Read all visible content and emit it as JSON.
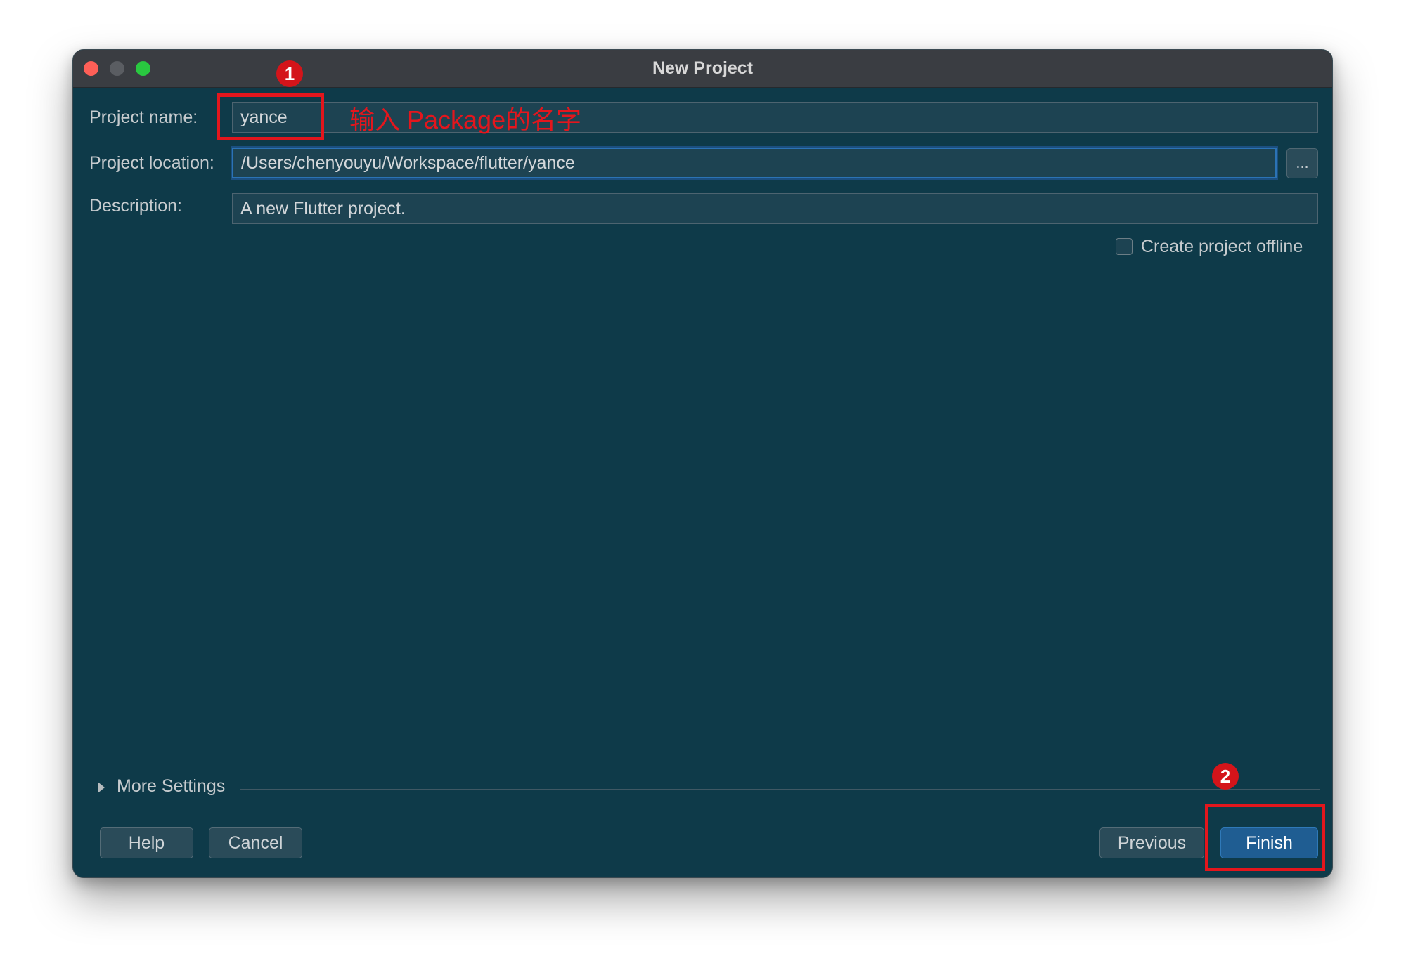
{
  "window": {
    "title": "New Project"
  },
  "form": {
    "project_name_label": "Project name:",
    "project_name_value": "yance",
    "project_location_label": "Project location:",
    "project_location_value": "/Users/chenyouyu/Workspace/flutter/yance",
    "browse_label": "...",
    "description_label": "Description:",
    "description_value": "A new Flutter project.",
    "offline_label": "Create project offline",
    "offline_checked": false
  },
  "more_settings": {
    "label": "More Settings"
  },
  "buttons": {
    "help": "Help",
    "cancel": "Cancel",
    "previous": "Previous",
    "finish": "Finish"
  },
  "annotations": {
    "badge_1": "1",
    "badge_2": "2",
    "hint_text": "输入 Package的名字",
    "color": "#e3161d"
  },
  "colors": {
    "window_background": "#0e3a49",
    "titlebar": "#3a3d42",
    "primary_button": "#1f5d92",
    "focus_border": "#2b73b5"
  },
  "icons": {
    "close": "traffic-light-close",
    "minimize": "traffic-light-minimize",
    "maximize": "traffic-light-maximize",
    "expand": "triangle-right-icon"
  }
}
